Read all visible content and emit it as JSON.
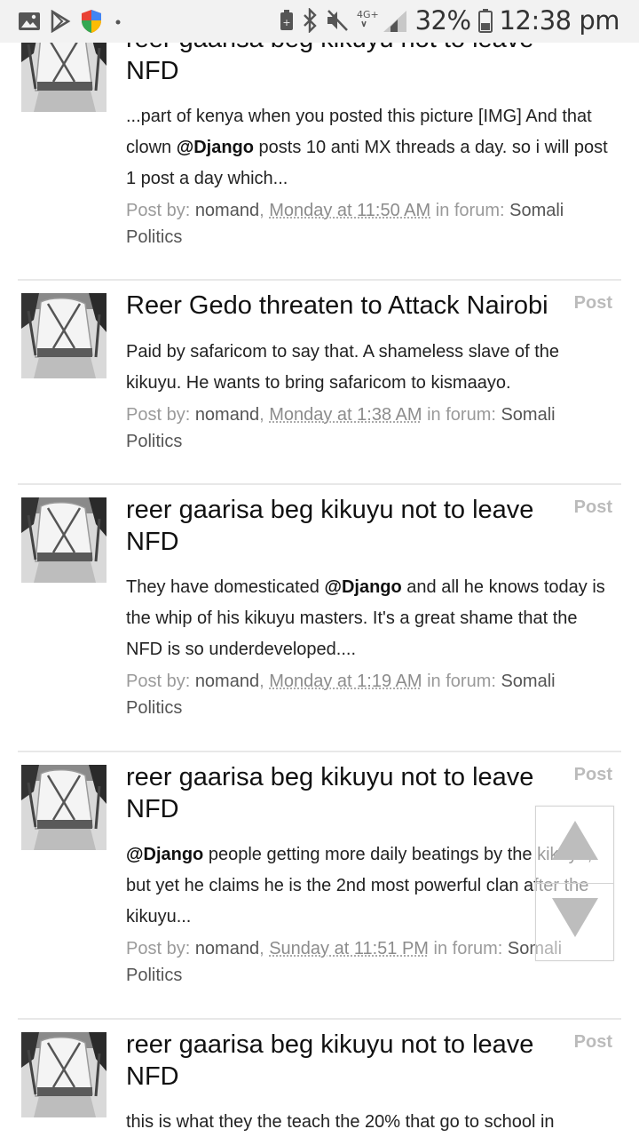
{
  "status_bar": {
    "network": "4G+",
    "battery": "32%",
    "time": "12:38 pm",
    "icons": [
      "image-icon",
      "play-store-icon",
      "shield-icon",
      "dot-icon",
      "battery-saver-icon",
      "bluetooth-icon",
      "mute-icon",
      "signal-icon",
      "battery-icon"
    ]
  },
  "post_tag": "Post",
  "posts": [
    {
      "title": "reer gaarisa beg kikuyu not to leave NFD",
      "snippet_before": "...part of kenya when you posted this picture [IMG] And that clown ",
      "mention": "@Django",
      "snippet_after": " posts 10 anti MX threads a day. so i will post 1 post a day which...",
      "meta_prefix": "Post by: ",
      "user": "nomand",
      "comma": ", ",
      "time": "Monday at 11:50 AM",
      "forum_label": " in forum: ",
      "forum": "Somali Politics"
    },
    {
      "title": "Reer Gedo threaten to Attack Nairobi",
      "snippet_before": "Paid by safaricom to say that. A shameless slave of the kikuyu. He wants to bring safaricom to kismaayo.",
      "mention": "",
      "snippet_after": "",
      "meta_prefix": "Post by: ",
      "user": "nomand",
      "comma": ", ",
      "time": "Monday at 1:38 AM",
      "forum_label": " in forum: ",
      "forum": "Somali Politics"
    },
    {
      "title": "reer gaarisa beg kikuyu not to leave NFD",
      "snippet_before": "They have domesticated ",
      "mention": "@Django",
      "snippet_after": " and all he knows today is the whip of his kikuyu masters. It's a great shame that the NFD is so underdeveloped....",
      "meta_prefix": "Post by: ",
      "user": "nomand",
      "comma": ", ",
      "time": "Monday at 1:19 AM",
      "forum_label": " in forum: ",
      "forum": "Somali Politics"
    },
    {
      "title": "reer gaarisa beg kikuyu not to leave NFD",
      "snippet_before": "",
      "mention": "@Django",
      "snippet_after": " people getting more daily beatings by the kikuyu, but yet he claims he is the 2nd most powerful clan after the kikuyu...",
      "meta_prefix": "Post by: ",
      "user": "nomand",
      "comma": ", ",
      "time": "Sunday at 11:51 PM",
      "forum_label": " in forum: ",
      "forum": "Somali Politics"
    },
    {
      "title": "reer gaarisa beg kikuyu not to leave NFD",
      "snippet_before": "this is what they the teach the 20% that go to school in",
      "mention": "",
      "snippet_after": "",
      "meta_prefix": "",
      "user": "",
      "comma": "",
      "time": "",
      "forum_label": "",
      "forum": ""
    }
  ],
  "scroll_controls": {
    "up_icon": "triangle-up-icon",
    "down_icon": "triangle-down-icon"
  }
}
